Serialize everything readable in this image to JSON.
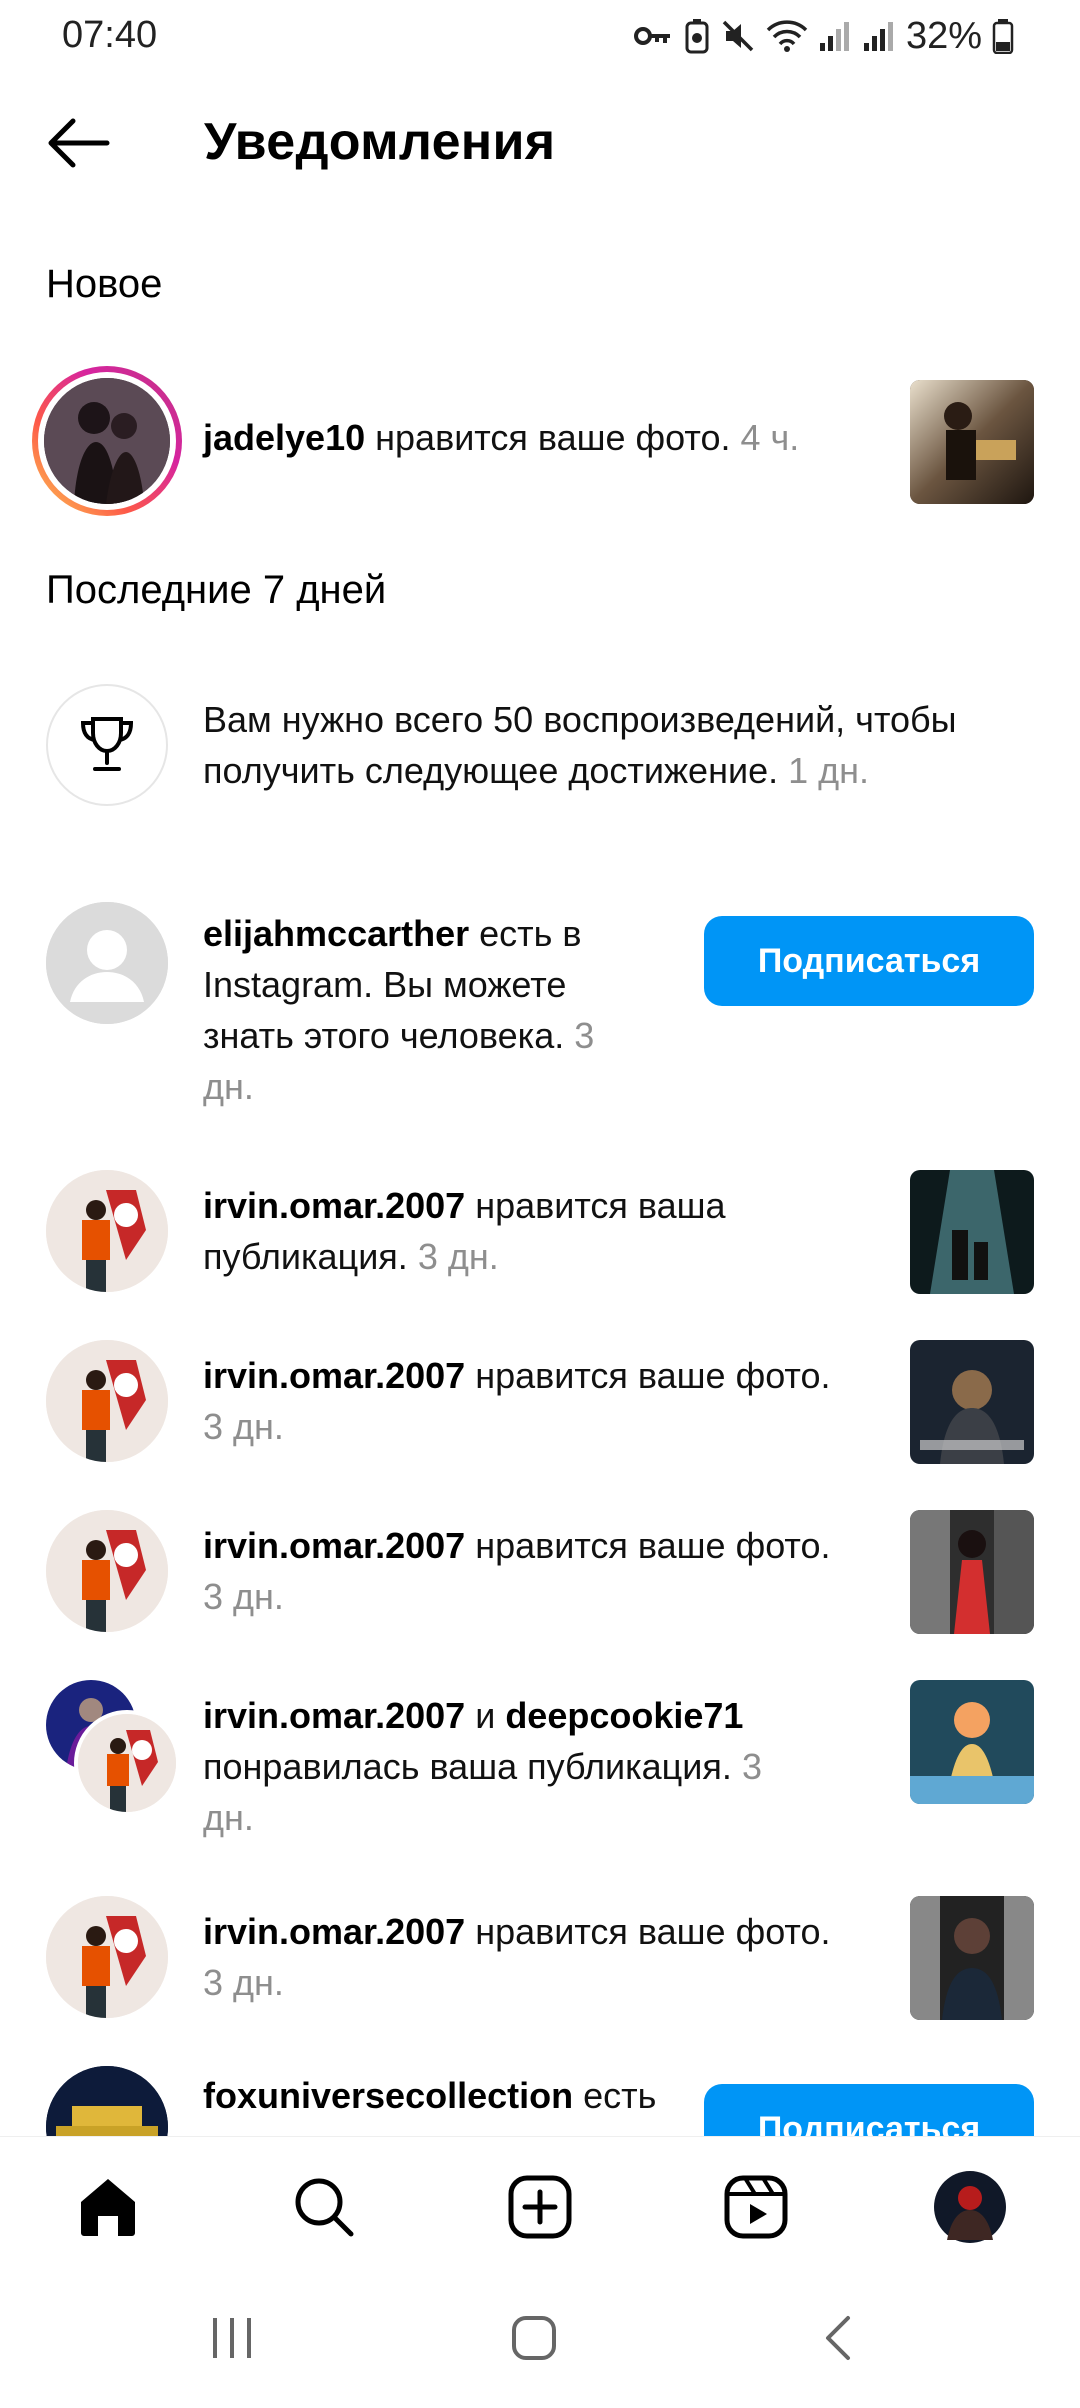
{
  "status_bar": {
    "time": "07:40",
    "battery": "32%",
    "icons": [
      "key-icon",
      "battery-saver-icon",
      "mute-icon",
      "wifi-icon",
      "signal-icon",
      "signal-icon",
      "battery-icon"
    ]
  },
  "header": {
    "title": "Уведомления",
    "back_icon": "arrow-left-icon"
  },
  "sections": {
    "new": "Новое",
    "last7": "Последние 7 дней"
  },
  "notifications": [
    {
      "user": "jadelye10",
      "text": "нравится ваше фото.",
      "time": "4 ч."
    },
    {
      "text": "Вам нужно всего 50 воспроизведений, чтобы получить следующее достижение.",
      "time": "1 дн."
    },
    {
      "user": "elijahmccarther",
      "text_1": "есть в",
      "text_2": "Instagram. Вы можете",
      "text_3": "знать этого человека.",
      "time_1": "3",
      "time_2": "дн.",
      "button": "Подписаться"
    },
    {
      "user": "irvin.omar.2007",
      "text_1": "нравится ваша",
      "text_2": "публикация.",
      "time": "3 дн."
    },
    {
      "user": "irvin.omar.2007",
      "text": "нравится ваше фото.",
      "time": "3 дн."
    },
    {
      "user": "irvin.omar.2007",
      "text": "нравится ваше фото.",
      "time": "3 дн."
    },
    {
      "user": "irvin.omar.2007",
      "and": "и",
      "user2": "deepcookie71",
      "text": "понравилась ваша публикация.",
      "time_1": "3",
      "time_2": "дн."
    },
    {
      "user": "irvin.omar.2007",
      "text": "нравится ваше фото.",
      "time": "3 дн."
    },
    {
      "user": "foxuniversecollection",
      "text": "есть",
      "button": "Подписаться"
    }
  ],
  "bottom_nav": [
    "home-icon",
    "search-icon",
    "create-icon",
    "reels-icon",
    "profile-avatar"
  ],
  "system_nav": [
    "recent-apps-icon",
    "home-button-icon",
    "back-icon"
  ],
  "colors": {
    "accent": "#0095f6",
    "muted_text": "#8e8e8e",
    "story_ring_start": "#fdcb52",
    "story_ring_end": "#c13584"
  }
}
